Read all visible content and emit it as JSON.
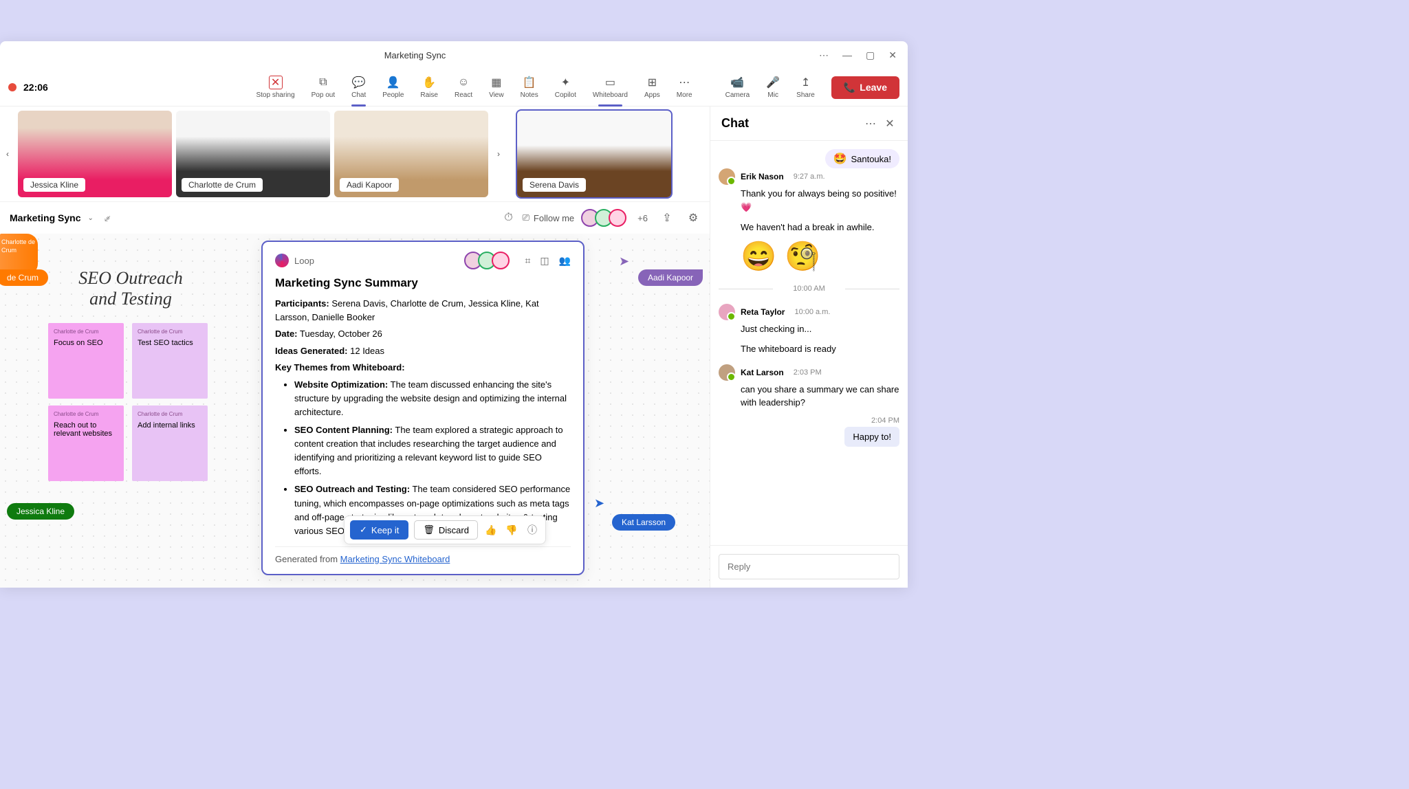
{
  "window": {
    "title": "Marketing Sync",
    "timer": "22:06"
  },
  "toolbar": {
    "stop": "Stop sharing",
    "popout": "Pop out",
    "chat": "Chat",
    "people": "People",
    "raise": "Raise",
    "react": "React",
    "view": "View",
    "notes": "Notes",
    "copilot": "Copilot",
    "whiteboard": "Whiteboard",
    "apps": "Apps",
    "more": "More",
    "camera": "Camera",
    "mic": "Mic",
    "share": "Share",
    "leave": "Leave"
  },
  "participants": {
    "p1": "Jessica Kline",
    "p2": "Charlotte de Crum",
    "p3": "Aadi Kapoor",
    "p4": "Serena Davis"
  },
  "docHeader": {
    "title": "Marketing Sync",
    "followMe": "Follow me",
    "moreCount": "+6"
  },
  "whiteboard": {
    "heading": "SEO Outreach and Testing",
    "notes": {
      "n1": {
        "author": "Charlotte de Crum",
        "text": "Focus on SEO"
      },
      "n2": {
        "author": "Charlotte de Crum",
        "text": "Test SEO tactics"
      },
      "n3": {
        "author": "Charlotte de Crum",
        "text": "Reach out to relevant websites"
      },
      "n4": {
        "author": "Charlotte de Crum",
        "text": "Add internal links"
      }
    },
    "cursors": {
      "c1": "Jessica Kline",
      "c2": "de Crum",
      "c3": "Aadi Kapoor",
      "c4": "Kat Larsson"
    }
  },
  "loop": {
    "brand": "Loop",
    "title": "Marketing Sync Summary",
    "participantsLabel": "Participants:",
    "participantsText": "Serena Davis, Charlotte de Crum, Jessica Kline, Kat Larsson, Danielle Booker",
    "dateLabel": "Date:",
    "dateText": "Tuesday, October 26",
    "ideasLabel": "Ideas Generated:",
    "ideasText": "12 Ideas",
    "themesLabel": "Key Themes from Whiteboard:",
    "themes": {
      "t1": {
        "head": "Website Optimization:",
        "body": "The team discussed enhancing the site's structure by upgrading the website design and optimizing the internal architecture."
      },
      "t2": {
        "head": "SEO Content Planning:",
        "body": "The team explored a strategic approach to content creation that includes researching the target audience and identifying and prioritizing a relevant keyword list to guide SEO efforts."
      },
      "t3": {
        "head": "SEO Outreach and Testing:",
        "body": "The team considered SEO performance tuning, which encompasses on-page optimizations such as meta tags and off-page strategies like outreach to relevant websites & testing various SEO tactics."
      }
    },
    "generated": "Generated from ",
    "generatedLink": "Marketing Sync Whiteboard"
  },
  "actions": {
    "keep": "Keep it",
    "discard": "Discard"
  },
  "chat": {
    "title": "Chat",
    "pill": "Santouka!",
    "m1": {
      "name": "Erik Nason",
      "time": "9:27 a.m.",
      "text1": "Thank you for always being so positive! 💗",
      "text2": "We haven't had a break in awhile."
    },
    "separator": "10:00 AM",
    "m2": {
      "name": "Reta Taylor",
      "time": "10:00 a.m.",
      "text1": "Just checking in...",
      "text2": "The whiteboard is ready"
    },
    "m3": {
      "name": "Kat Larson",
      "time": "2:03 PM",
      "text1": "can you share a summary we can share with leadership?"
    },
    "self": {
      "time": "2:04 PM",
      "text": "Happy to!"
    },
    "reply": "Reply"
  }
}
